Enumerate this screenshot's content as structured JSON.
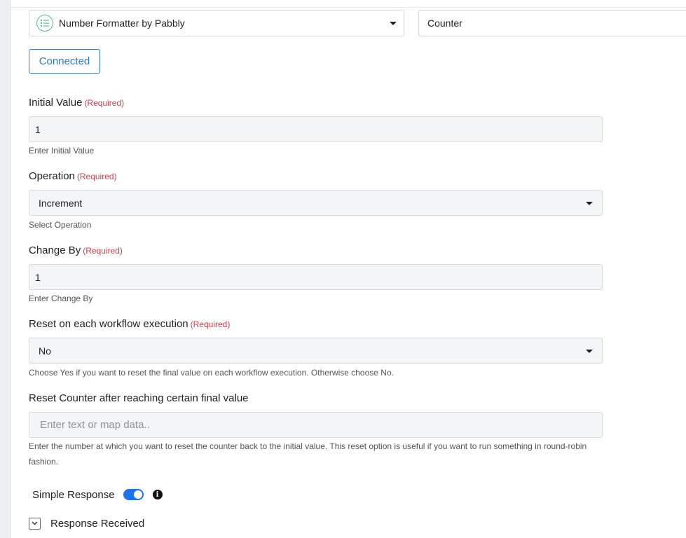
{
  "app_select": {
    "icon": "list-format-icon",
    "value": "Number Formatter by Pabbly"
  },
  "action_select": {
    "value": "Counter"
  },
  "connection": {
    "label": "Connected"
  },
  "required_text": "(Required)",
  "fields": {
    "initial_value": {
      "label": "Initial Value",
      "value": "1",
      "hint": "Enter Initial Value"
    },
    "operation": {
      "label": "Operation",
      "value": "Increment",
      "hint": "Select Operation"
    },
    "change_by": {
      "label": "Change By",
      "value": "1",
      "hint": "Enter Change By"
    },
    "reset_each": {
      "label": "Reset on each workflow execution",
      "value": "No",
      "hint": "Choose Yes if you want to reset the final value on each workflow execution. Otherwise choose No."
    },
    "reset_after": {
      "label": "Reset Counter after reaching certain final value",
      "placeholder": "Enter text or map data..",
      "hint": "Enter the number at which you want to reset the counter back to the initial value. This reset option is useful if you want to run something in round-robin fashion."
    }
  },
  "simple_response": {
    "label": "Simple Response",
    "enabled": true
  },
  "response_received": {
    "label": "Response Received"
  },
  "colors": {
    "accent": "#2a7dd1",
    "toggle_on": "#1a73e8",
    "required": "#d23b4b",
    "field_bg": "#f3f5f7",
    "app_icon": "#4fbf8b"
  }
}
